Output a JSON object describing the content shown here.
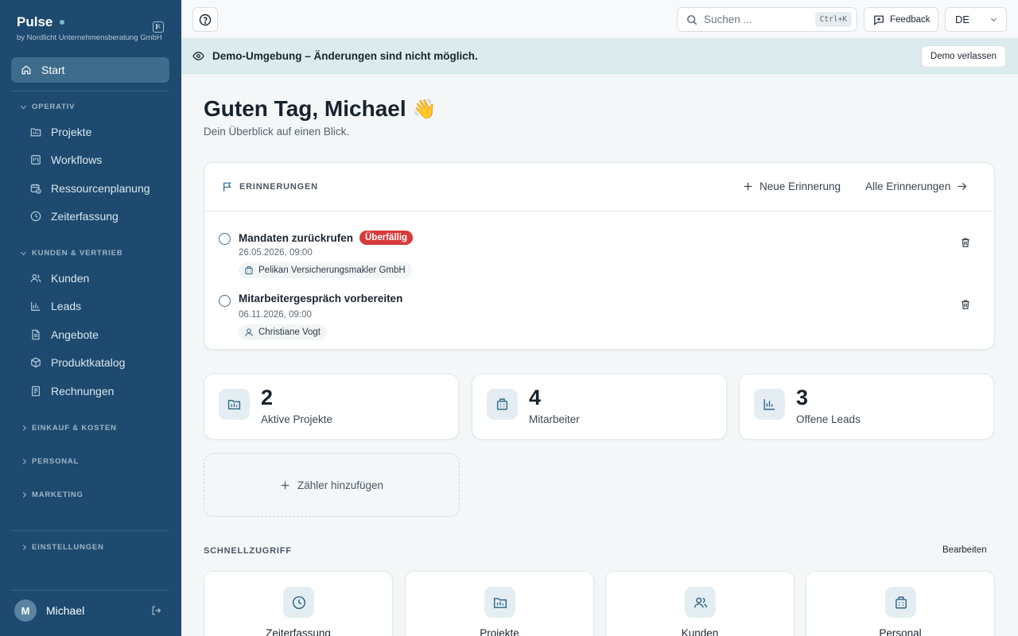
{
  "brand": {
    "title": "Pulse",
    "subtitle": "by Nordlicht Unternehmensberatung GmbH"
  },
  "sidebar": {
    "start_label": "Start",
    "sections": [
      {
        "title": "OPERATIV",
        "expanded": true,
        "items": [
          "Projekte",
          "Workflows",
          "Ressourcenplanung",
          "Zeiterfassung"
        ]
      },
      {
        "title": "KUNDEN & VERTRIEB",
        "expanded": true,
        "items": [
          "Kunden",
          "Leads",
          "Angebote",
          "Produktkatalog",
          "Rechnungen"
        ]
      },
      {
        "title": "EINKAUF & KOSTEN",
        "expanded": false
      },
      {
        "title": "PERSONAL",
        "expanded": false
      },
      {
        "title": "MARKETING",
        "expanded": false
      },
      {
        "title": "EINSTELLUNGEN",
        "expanded": false
      }
    ],
    "user": {
      "initial": "M",
      "name": "Michael"
    }
  },
  "topbar": {
    "search_placeholder": "Suchen ...",
    "search_shortcut": "Ctrl+K",
    "feedback_label": "Feedback",
    "language": "DE"
  },
  "banner": {
    "text": "Demo-Umgebung – Änderungen sind nicht möglich.",
    "exit_label": "Demo verlassen"
  },
  "main": {
    "greeting": "Guten Tag, Michael",
    "greeting_emoji": "👋",
    "subtitle": "Dein Überblick auf einen Blick.",
    "reminders": {
      "title": "ERINNERUNGEN",
      "new_label": "Neue Erinnerung",
      "all_label": "Alle Erinnerungen",
      "items": [
        {
          "title": "Mandaten zurückrufen",
          "badge": "Überfällig",
          "date": "26.05.2026, 09:00",
          "chip": "Pelikan Versicherungsmakler GmbH",
          "chip_icon": "building-icon"
        },
        {
          "title": "Mitarbeitergespräch vorbereiten",
          "badge": "",
          "date": "06.11.2026, 09:00",
          "chip": "Christiane Vogt",
          "chip_icon": "user-icon"
        }
      ]
    },
    "stats": [
      {
        "value": "2",
        "label": "Aktive Projekte",
        "icon": "folder-icon"
      },
      {
        "value": "4",
        "label": "Mitarbeiter",
        "icon": "building-icon"
      },
      {
        "value": "3",
        "label": "Offene Leads",
        "icon": "bar-chart-icon"
      }
    ],
    "add_counter_label": "Zähler hinzufügen",
    "quick_access": {
      "title": "SCHNELLZUGRIFF",
      "edit_label": "Bearbeiten",
      "items": [
        {
          "label": "Zeiterfassung",
          "icon": "clock-icon"
        },
        {
          "label": "Projekte",
          "icon": "folder-icon"
        },
        {
          "label": "Kunden",
          "icon": "users-icon"
        },
        {
          "label": "Personal",
          "icon": "building-icon"
        }
      ]
    }
  },
  "colors": {
    "sidebar_bg": "#1d4a6e",
    "sidebar_active": "#3d6c8d",
    "banner_bg": "#dcecee",
    "overdue_badge": "#d83a3a",
    "icon_tint": "#2f6688"
  }
}
